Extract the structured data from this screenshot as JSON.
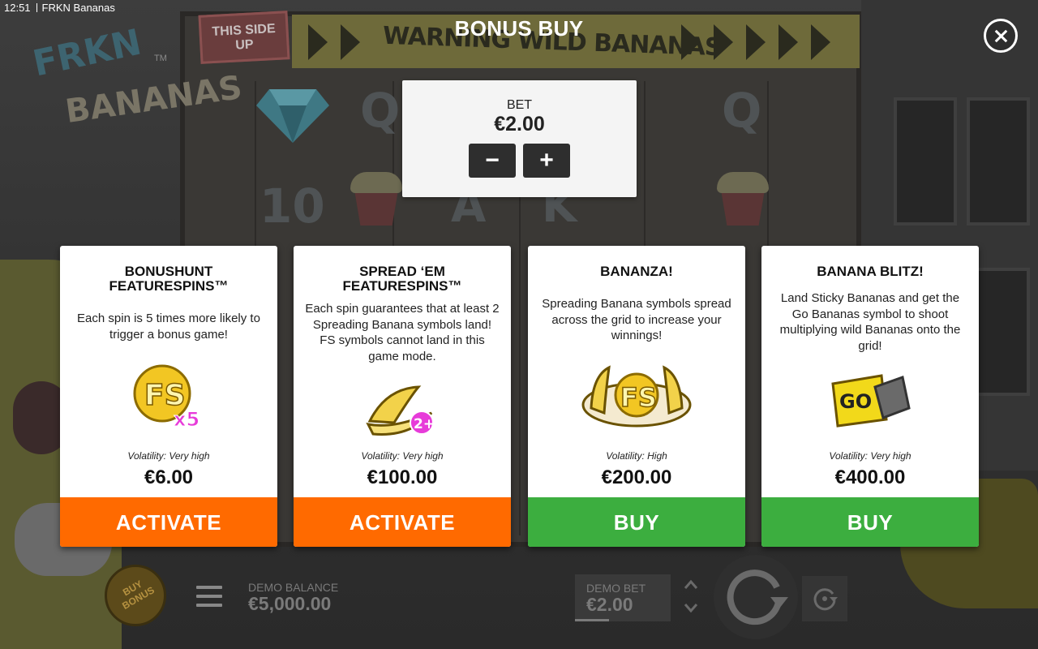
{
  "status_bar": {
    "time": "12:51",
    "app_title": "FRKN Bananas"
  },
  "background": {
    "logo_line1": "FRKN",
    "logo_line2": "BANANAS",
    "logo_tm": "TM",
    "sign_warning": "WARNING WILD BANANAS",
    "sign_this_side": "THIS SIDE UP"
  },
  "modal": {
    "title": "BONUS BUY",
    "close_icon": "close-icon"
  },
  "bet": {
    "label": "BET",
    "value": "€2.00",
    "minus_label": "−",
    "plus_label": "+"
  },
  "cards": [
    {
      "title": "BONUSHUNT FEATURESPINS™",
      "description": "Each spin is 5 times more likely to trigger a bonus game!",
      "art_icon": "fs-x5-icon",
      "art_text": "FS",
      "art_badge": "x5",
      "volatility": "Volatility: Very high",
      "price": "€6.00",
      "button": "ACTIVATE",
      "button_color": "#ff6a00"
    },
    {
      "title": "SPREAD ‘EM FEATURESPINS™",
      "description": "Each spin guarantees that at least 2 Spreading Banana symbols land! FS symbols cannot land in this game mode.",
      "art_icon": "spreading-banana-icon",
      "art_badge": "2+",
      "volatility": "Volatility: Very high",
      "price": "€100.00",
      "button": "ACTIVATE",
      "button_color": "#ff6a00"
    },
    {
      "title": "BANANZA!",
      "description": "Spreading Banana symbols spread across the grid to increase your winnings!",
      "art_icon": "fs-bananas-icon",
      "art_text": "FS",
      "volatility": "Volatility: High",
      "price": "€200.00",
      "button": "BUY",
      "button_color": "#3cae3f"
    },
    {
      "title": "BANANA BLITZ!",
      "description": "Land Sticky Bananas and get the Go Bananas symbol to shoot multiplying wild Bananas onto the grid!",
      "art_icon": "go-bananas-icon",
      "art_text": "GO",
      "volatility": "Volatility: Very high",
      "price": "€400.00",
      "button": "BUY",
      "button_color": "#3cae3f"
    }
  ],
  "bottom_bar": {
    "buy_bonus_label": "BUY BONUS",
    "menu_icon": "hamburger-menu-icon",
    "demo_balance_label": "DEMO BALANCE",
    "demo_balance_value": "€5,000.00",
    "demo_bet_label": "DEMO BET",
    "demo_bet_value": "€2.00",
    "bet_up_icon": "chevron-up-icon",
    "bet_down_icon": "chevron-down-icon",
    "spin_icon": "spin-arrow-icon",
    "autoplay_icon": "autoplay-icon"
  }
}
